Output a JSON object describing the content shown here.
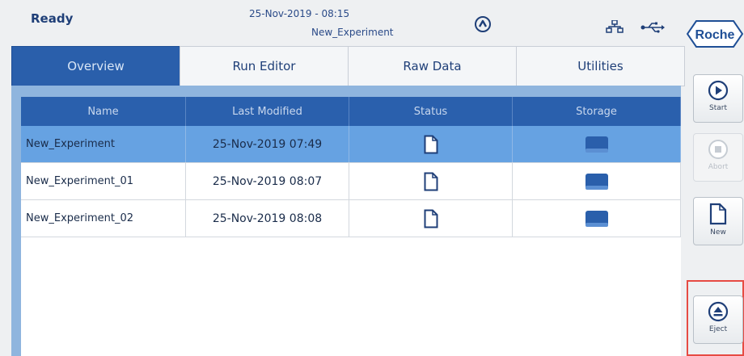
{
  "header": {
    "status": "Ready",
    "datetime": "25-Nov-2019 - 08:15",
    "experiment": "New_Experiment",
    "logo": "Roche"
  },
  "icons": {
    "lock": "lock-icon",
    "network": "network-icon",
    "usb": "usb-icon"
  },
  "tabs": [
    {
      "label": "Overview",
      "active": true
    },
    {
      "label": "Run Editor",
      "active": false
    },
    {
      "label": "Raw Data",
      "active": false
    },
    {
      "label": "Utilities",
      "active": false
    }
  ],
  "table": {
    "columns": [
      "Name",
      "Last Modified",
      "Status",
      "Storage"
    ],
    "rows": [
      {
        "name": "New_Experiment",
        "modified": "25-Nov-2019 07:49",
        "status_icon": "document-icon",
        "storage_icon": "storage-icon",
        "selected": true
      },
      {
        "name": "New_Experiment_01",
        "modified": "25-Nov-2019 08:07",
        "status_icon": "document-icon",
        "storage_icon": "storage-icon",
        "selected": false
      },
      {
        "name": "New_Experiment_02",
        "modified": "25-Nov-2019 08:08",
        "status_icon": "document-icon",
        "storage_icon": "storage-icon",
        "selected": false
      }
    ]
  },
  "sidebar": {
    "start": "Start",
    "abort": "Abort",
    "new": "New",
    "eject": "Eject"
  },
  "colors": {
    "accent": "#2a5fab",
    "selected_row": "#66a2e2",
    "panel": "#8fb5de",
    "highlight_border": "#e64b43"
  }
}
